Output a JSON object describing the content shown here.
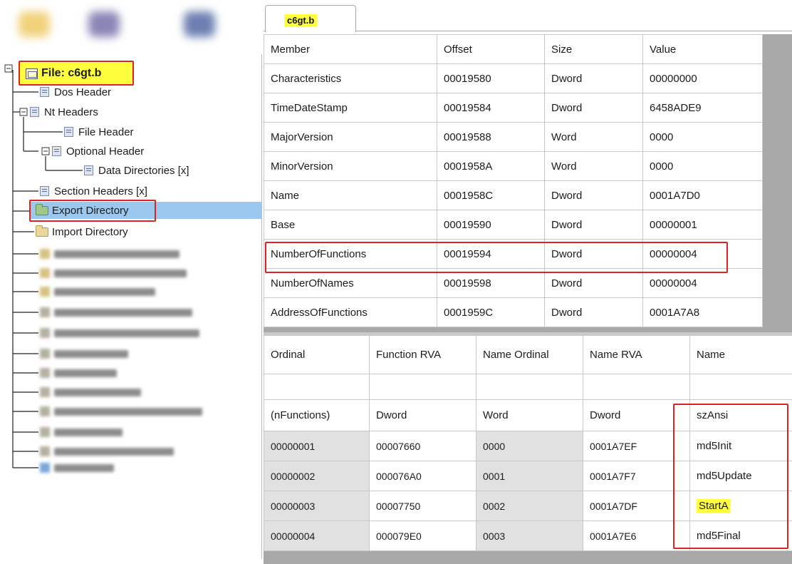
{
  "tab": {
    "label": "c6gt.b"
  },
  "tree": {
    "root_label": "File: c6gt.b",
    "items": [
      {
        "label": "Dos Header"
      },
      {
        "label": "Nt Headers"
      },
      {
        "label": "File Header"
      },
      {
        "label": "Optional Header"
      },
      {
        "label": "Data Directories [x]"
      },
      {
        "label": "Section Headers [x]"
      },
      {
        "label": "Export Directory"
      },
      {
        "label": "Import Directory"
      }
    ],
    "selected": "Export Directory"
  },
  "member_table": {
    "headers": [
      "Member",
      "Offset",
      "Size",
      "Value"
    ],
    "rows": [
      [
        "Characteristics",
        "00019580",
        "Dword",
        "00000000"
      ],
      [
        "TimeDateStamp",
        "00019584",
        "Dword",
        "6458ADE9"
      ],
      [
        "MajorVersion",
        "00019588",
        "Word",
        "0000"
      ],
      [
        "MinorVersion",
        "0001958A",
        "Word",
        "0000"
      ],
      [
        "Name",
        "0001958C",
        "Dword",
        "0001A7D0"
      ],
      [
        "Base",
        "00019590",
        "Dword",
        "00000001"
      ],
      [
        "NumberOfFunctions",
        "00019594",
        "Dword",
        "00000004"
      ],
      [
        "NumberOfNames",
        "00019598",
        "Dword",
        "00000004"
      ],
      [
        "AddressOfFunctions",
        "0001959C",
        "Dword",
        "0001A7A8"
      ]
    ]
  },
  "export_table": {
    "headers": [
      "Ordinal",
      "Function RVA",
      "Name Ordinal",
      "Name RVA",
      "Name"
    ],
    "types": [
      "(nFunctions)",
      "Dword",
      "Word",
      "Dword",
      "szAnsi"
    ],
    "rows": [
      [
        "00000001",
        "00007660",
        "0000",
        "0001A7EF",
        "md5Init"
      ],
      [
        "00000002",
        "000076A0",
        "0001",
        "0001A7F7",
        "md5Update"
      ],
      [
        "00000003",
        "00007750",
        "0002",
        "0001A7DF",
        "StartA"
      ],
      [
        "00000004",
        "000079E0",
        "0003",
        "0001A7E6",
        "md5Final"
      ]
    ]
  },
  "colors": {
    "highlight_yellow": "#ffff3d",
    "annotation_red": "#dd2222",
    "selection_blue": "#9cc7ee"
  }
}
